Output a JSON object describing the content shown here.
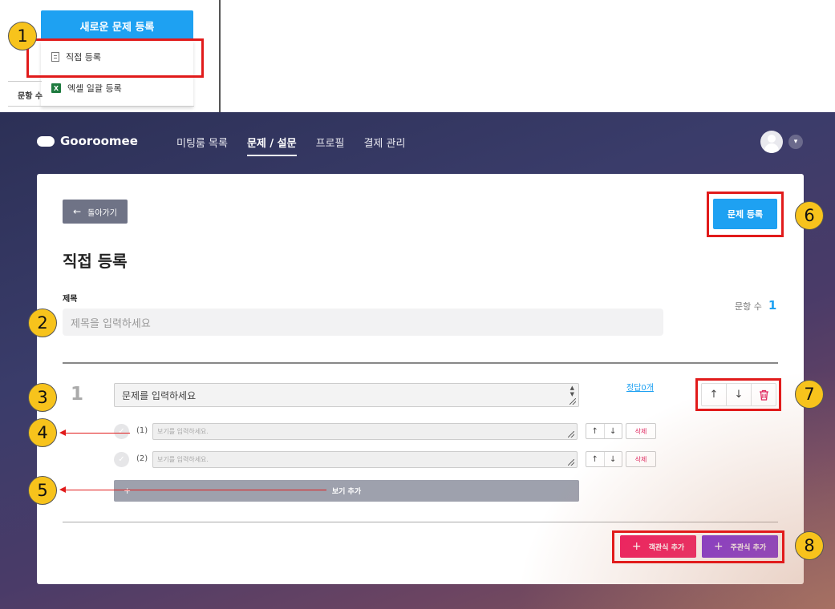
{
  "snippet": {
    "new_button": "새로운 문제 등록",
    "menu": [
      {
        "label": "직접 등록",
        "icon": "document-icon"
      },
      {
        "label": "엑셀 일괄 등록",
        "icon": "excel-icon"
      }
    ],
    "side_count_label": "문항 수"
  },
  "markers": [
    "1",
    "2",
    "3",
    "4",
    "5",
    "6",
    "7",
    "8"
  ],
  "nav": {
    "brand": "Gooroomee",
    "links": [
      "미팅룸 목록",
      "문제 / 설문",
      "프로필",
      "결제 관리"
    ],
    "active_index": 1
  },
  "page": {
    "back_label": "돌아가기",
    "submit_label": "문제 등록",
    "title": "직접 등록",
    "title_field_label": "제목",
    "title_placeholder": "제목을 입력하세요",
    "count_label": "문항 수",
    "count_value": "1"
  },
  "question": {
    "number": "1",
    "placeholder": "문제를 입력하세요",
    "answer_link": "정답0개",
    "options": [
      {
        "num": "(1)",
        "placeholder": "보기를 입력하세요.",
        "delete": "삭제"
      },
      {
        "num": "(2)",
        "placeholder": "보기를 입력하세요.",
        "delete": "삭제"
      }
    ],
    "add_option_label": "보기 추가"
  },
  "footer": {
    "multiple_choice_label": "객관식 추가",
    "short_answer_label": "주관식 추가"
  },
  "colors": {
    "primary": "#1ea1f2",
    "pink": "#f0185e",
    "purple": "#7a2ad6",
    "marker": "#f7c31c",
    "highlight": "#e11b1b"
  }
}
